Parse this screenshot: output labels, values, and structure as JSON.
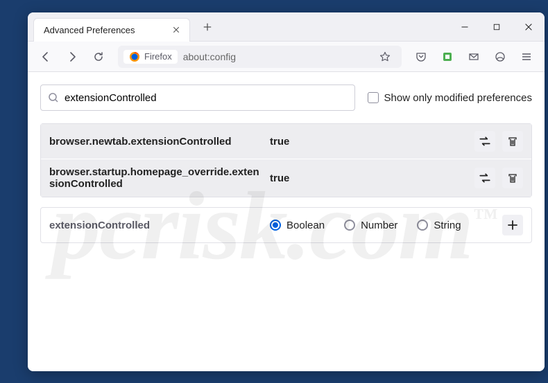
{
  "window": {
    "tab_title": "Advanced Preferences"
  },
  "toolbar": {
    "identity_label": "Firefox",
    "url": "about:config"
  },
  "search": {
    "value": "extensionControlled",
    "checkbox_label": "Show only modified preferences"
  },
  "prefs": [
    {
      "name": "browser.newtab.extensionControlled",
      "value": "true"
    },
    {
      "name": "browser.startup.homepage_override.extensionControlled",
      "value": "true"
    }
  ],
  "newpref": {
    "name": "extensionControlled",
    "types": [
      "Boolean",
      "Number",
      "String"
    ],
    "selected": "Boolean"
  },
  "watermark": "pcrisk.com"
}
